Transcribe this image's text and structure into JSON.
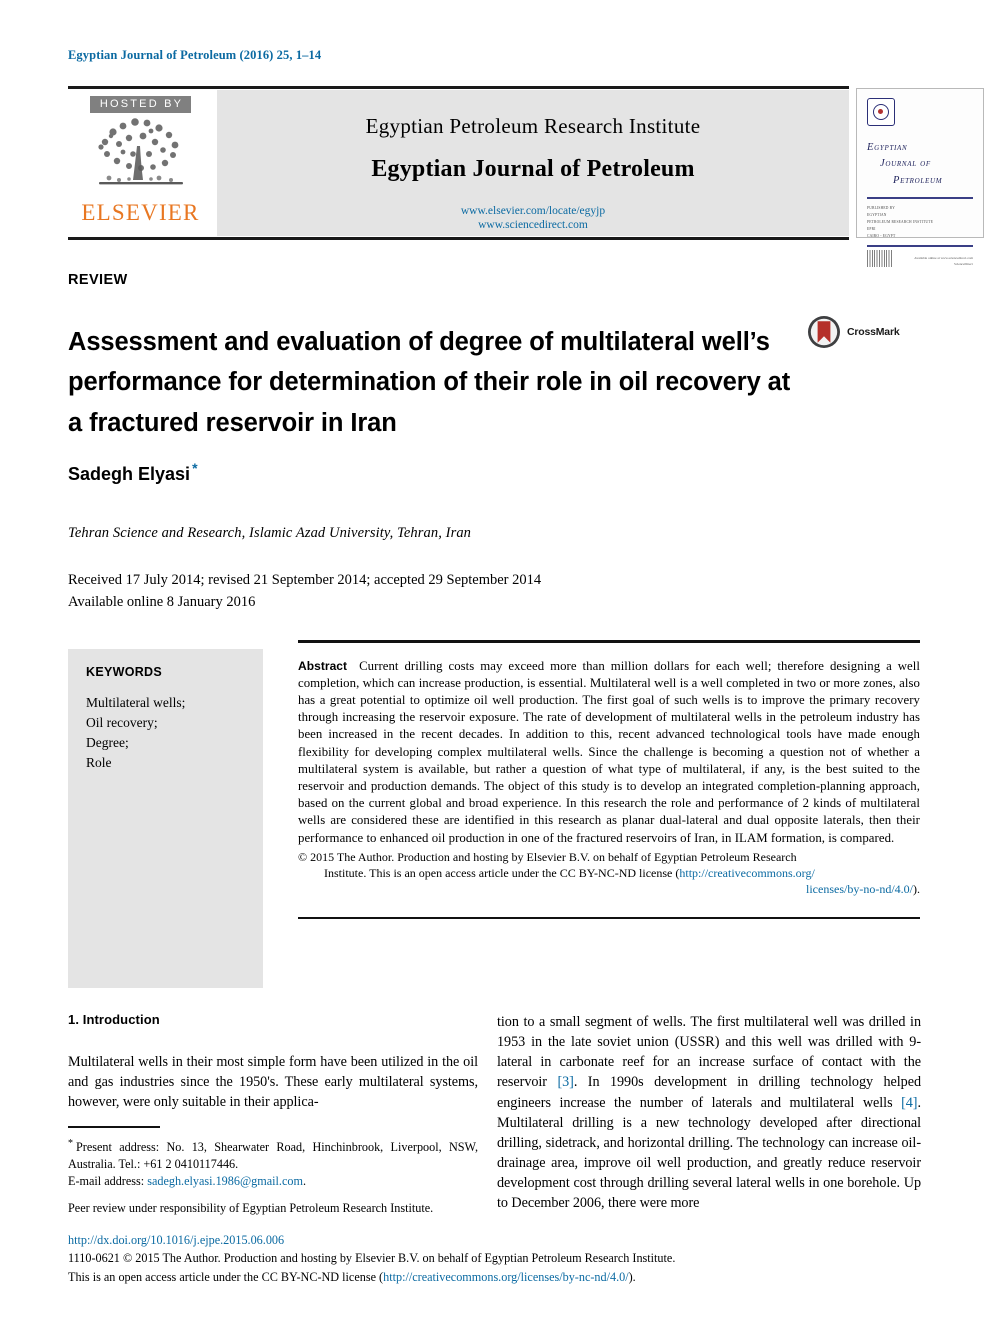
{
  "running_head": "Egyptian Journal of Petroleum (2016) 25, 1–14",
  "masthead": {
    "hosted_by": "HOSTED BY",
    "publisher": "ELSEVIER",
    "institute": "Egyptian Petroleum Research Institute",
    "journal_title": "Egyptian Journal of Petroleum",
    "link_locate": "www.elsevier.com/locate/egyjp",
    "link_sciencedirect": "www.sciencedirect.com"
  },
  "cover": {
    "line1": "Egyptian",
    "line2": "Journal of",
    "line3": "Petroleum",
    "meta": "PUBLISHED BY\nEGYPTIAN\nPETROLEUM RESEARCH INSTITUTE\nEPRI\nCAIRO - EGYPT",
    "foot_text": "Available online at www.sciencedirect.com\nScienceDirect"
  },
  "article": {
    "type": "REVIEW",
    "title": "Assessment and evaluation of degree of multilateral well’s performance for determination of their role in oil recovery at a fractured reservoir in Iran",
    "crossmark_label": "CrossMark",
    "author": "Sadegh Elyasi",
    "author_marker": "*",
    "affiliation": "Tehran Science and Research, Islamic Azad University, Tehran, Iran",
    "history_received": "Received 17 July 2014; revised 21 September 2014; accepted 29 September 2014",
    "history_online": "Available online 8 January 2016"
  },
  "keywords": {
    "heading": "KEYWORDS",
    "items": [
      "Multilateral wells;",
      "Oil recovery;",
      "Degree;",
      "Role"
    ]
  },
  "abstract": {
    "label": "Abstract",
    "text": "Current drilling costs may exceed more than million dollars for each well; therefore designing a well completion, which can increase production, is essential. Multilateral well is a well completed in two or more zones, also has a great potential to optimize oil well production. The first goal of such wells is to improve the primary recovery through increasing the reservoir exposure. The rate of development of multilateral wells in the petroleum industry has been increased in the recent decades. In addition to this, recent advanced technological tools have made enough flexibility for developing complex multilateral wells. Since the challenge is becoming a question not of whether a multilateral system is available, but rather a question of what type of multilateral, if any, is the best suited to the reservoir and production demands. The object of this study is to develop an integrated completion-planning approach, based on the current global and broad experience. In this research the role and performance of 2 kinds of multilateral wells are considered these are identified in this research as planar dual-lateral and dual opposite laterals, then their performance to enhanced oil production in one of the fractured reservoirs of Iran, in ILAM formation, is compared.",
    "copyright_line1": "© 2015 The Author. Production and hosting by Elsevier B.V. on behalf of Egyptian Petroleum Research",
    "copyright_line2": "Institute.  This is an open access article under the CC BY-NC-ND license (",
    "copyright_link1": "http://creativecommons.org/",
    "copyright_link2": "licenses/by-no-nd/4.0/",
    "copyright_end": ")."
  },
  "body": {
    "section_heading": "1. Introduction",
    "left_paragraph": "Multilateral wells in their most simple form have been utilized in the oil and gas industries since the 1950's. These early multilateral systems, however, were only suitable in their applica-",
    "right_paragraph_part1": "tion to a small segment of wells. The first multilateral well was drilled in 1953 in the late soviet union (USSR) and this well was drilled with 9-lateral in carbonate reef for an increase surface of contact with the reservoir ",
    "right_ref_3": "[3]",
    "right_paragraph_part2": ". In 1990s development in drilling technology helped engineers increase the number of laterals and multilateral wells ",
    "right_ref_4": "[4]",
    "right_paragraph_part3": ". Multilateral drilling is a new technology developed after directional drilling, sidetrack, and horizontal drilling. The technology can increase oil-drainage area, improve oil well production, and greatly reduce reservoir development cost through drilling several lateral wells in one borehole. Up to December 2006, there were more"
  },
  "footnote": {
    "marker": "*",
    "present_address": "Present address: No. 13, Shearwater Road, Hinchinbrook, Liverpool, NSW, Australia. Tel.: +61 2 0410117446.",
    "email_label": "E-mail address: ",
    "email": "sadegh.elyasi.1986@gmail.com",
    "email_end": ".",
    "peer_review": "Peer review under responsibility of Egyptian Petroleum Research Institute."
  },
  "page_footer": {
    "doi": "http://dx.doi.org/10.1016/j.ejpe.2015.06.006",
    "line1": "1110-0621 © 2015 The Author. Production and hosting by Elsevier B.V. on behalf of Egyptian Petroleum Research Institute.",
    "line2_prefix": "This is an open access article under the CC BY-NC-ND license (",
    "line2_link": "http://creativecommons.org/licenses/by-nc-nd/4.0/",
    "line2_suffix": ")."
  },
  "colors": {
    "link": "#0b6aa2",
    "elsevier_orange": "#E87722",
    "band_gray": "#e4e4e4",
    "crossmark_red": "#b5302a"
  }
}
